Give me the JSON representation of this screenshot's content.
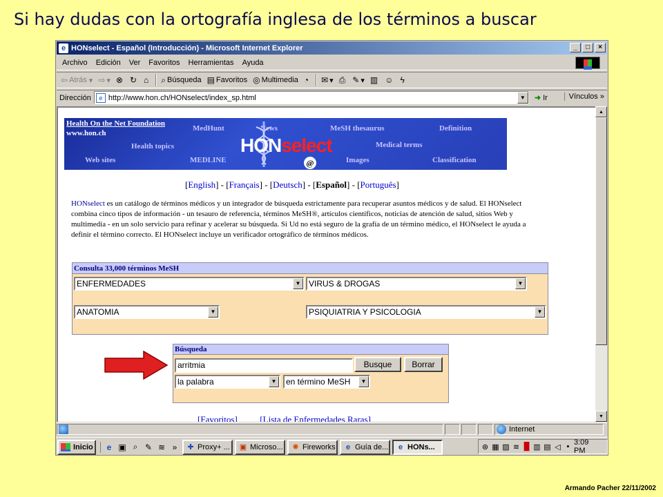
{
  "slide": {
    "title": "Si hay dudas con la ortografía inglesa de los términos a buscar",
    "footer": "Armando Pacher 22/11/2002"
  },
  "window": {
    "title": "HONselect - Español (Introducción) - Microsoft Internet Explorer",
    "minimize": "_",
    "maximize": "□",
    "close": "×"
  },
  "menu": {
    "items": [
      "Archivo",
      "Edición",
      "Ver",
      "Favoritos",
      "Herramientas",
      "Ayuda"
    ]
  },
  "toolbar": {
    "back": "Atrás",
    "search": "Búsqueda",
    "favorites": "Favoritos",
    "multimedia": "Multimedia"
  },
  "address": {
    "label": "Dirección",
    "url": "http://www.hon.ch/HONselect/index_sp.html",
    "go": "Ir",
    "links": "Vínculos"
  },
  "banner": {
    "org_link": "Health On the Net Foundation",
    "org_url": "www.hon.ch",
    "nav": {
      "medhunt": "MedHunt",
      "news": "News",
      "mesh_thesaurus": "MeSH thesaurus",
      "definition": "Definition",
      "health_topics": "Health topics",
      "medical_terms": "Medical terms",
      "web_sites": "Web sites",
      "medline": "MEDLINE",
      "images": "Images",
      "classification": "Classification"
    },
    "logo_hon": "HON",
    "logo_select": "select",
    "logo_at": "@"
  },
  "languages": {
    "english": "English",
    "francais": "Français",
    "deutsch": "Deutsch",
    "espanol": "Español",
    "portugues": "Português"
  },
  "description": {
    "p1_kw": "HONselect",
    "p1_rest": " es un catálogo de términos médicos y un integrador de búsqueda estrictamente para recuperar asuntos médicos y de salud. El HONselect combina cinco tipos de información - un tesauro de referencia, términos MeSH®, artículos científicos, noticias de atención de salud, sitios Web y multimedia - en un solo servicio para refinar y acelerar su búsqueda. Si Ud no está seguro de la grafía de un término médico, el HONselect le ayuda a definir el término correcto. El HONselect incluye un verificador ortográfico de términos médicos."
  },
  "mesh": {
    "header": "Consulta 33,000 términos MeSH",
    "select1": "ENFERMEDADES",
    "select2": "VIRUS & DROGAS",
    "select3": "ANATOMIA",
    "select4": "PSIQUIATRIA Y PSICOLOGIA"
  },
  "busqueda": {
    "header": "Búsqueda",
    "query": "arritmia",
    "search_button": "Busque",
    "clear_button": "Borrar",
    "mode_select": "la palabra",
    "scope_select": "en término MeSH"
  },
  "bottom_links": {
    "favoritos": "Favoritos",
    "lista": "Lista de Enfermedades Raras"
  },
  "status": {
    "zone": "Internet"
  },
  "taskbar": {
    "start": "Inicio",
    "tasks": [
      "Proxy+ ...",
      "Microso...",
      "Fireworks",
      "Guía de...",
      "HONs..."
    ],
    "clock": "3:09 PM"
  },
  "colors": {
    "slide_bg": "#ffff99",
    "banner_blue": "#2840b8",
    "form_bg": "#fbdfb0",
    "form_header": "#c8ccf8",
    "arrow": "#e02020"
  }
}
